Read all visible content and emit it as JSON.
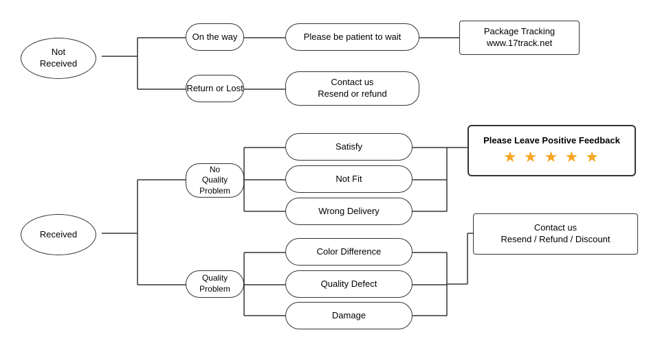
{
  "nodes": {
    "not_received": {
      "label": "Not\nReceived"
    },
    "on_the_way": {
      "label": "On the way"
    },
    "patient": {
      "label": "Please be patient to wait"
    },
    "package_tracking": {
      "label": "Package Tracking\nwww.17track.net"
    },
    "return_or_lost": {
      "label": "Return or Lost"
    },
    "contact_resend_refund": {
      "label": "Contact us\nResend or refund"
    },
    "received": {
      "label": "Received"
    },
    "no_quality_problem": {
      "label": "No\nQuality Problem"
    },
    "satisfy": {
      "label": "Satisfy"
    },
    "not_fit": {
      "label": "Not Fit"
    },
    "wrong_delivery": {
      "label": "Wrong Delivery"
    },
    "quality_problem": {
      "label": "Quality Problem"
    },
    "color_difference": {
      "label": "Color Difference"
    },
    "quality_defect": {
      "label": "Quality Defect"
    },
    "damage": {
      "label": "Damage"
    },
    "please_leave": {
      "label": "Please Leave Positive Feedback"
    },
    "stars": {
      "label": "★ ★ ★ ★ ★"
    },
    "contact_resend_refund_discount": {
      "label": "Contact us\nResend / Refund / Discount"
    }
  }
}
